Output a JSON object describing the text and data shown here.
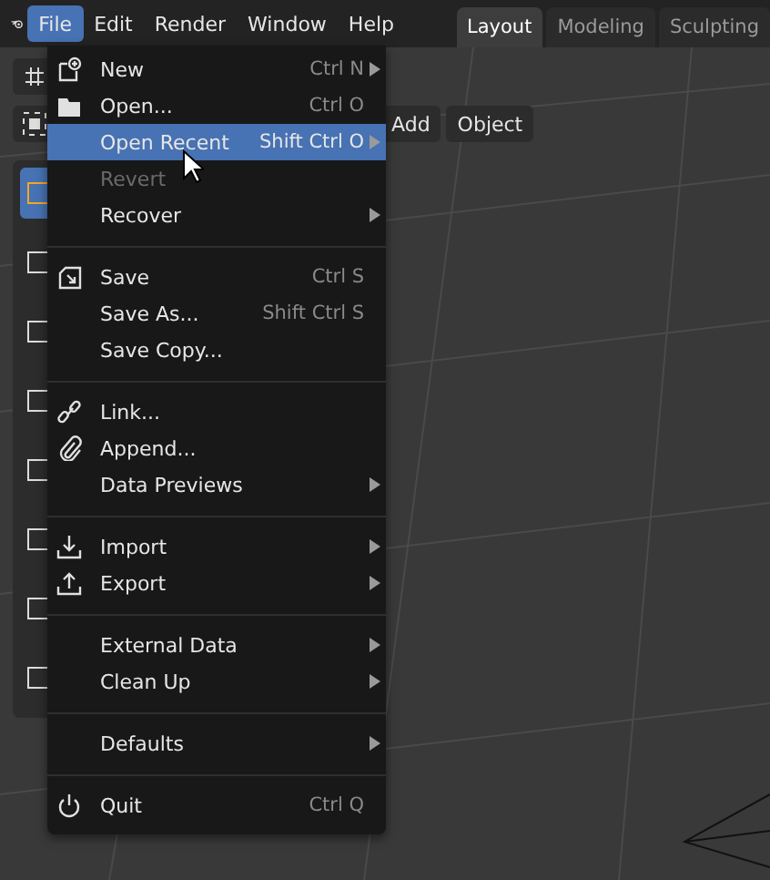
{
  "menubar": {
    "items": [
      {
        "label": "File",
        "selected": true
      },
      {
        "label": "Edit",
        "selected": false
      },
      {
        "label": "Render",
        "selected": false
      },
      {
        "label": "Window",
        "selected": false
      },
      {
        "label": "Help",
        "selected": false
      }
    ]
  },
  "workspace_tabs": [
    {
      "label": "Layout",
      "selected": true
    },
    {
      "label": "Modeling",
      "selected": false
    },
    {
      "label": "Sculpting",
      "selected": false
    }
  ],
  "viewport_header": {
    "buttons": [
      "Add",
      "Object"
    ]
  },
  "file_menu": {
    "items": [
      {
        "kind": "item",
        "label": "New",
        "shortcut": "Ctrl N",
        "submenu": true,
        "selected": false,
        "disabled": false
      },
      {
        "kind": "item",
        "label": "Open...",
        "shortcut": "Ctrl O",
        "submenu": false,
        "selected": false,
        "disabled": false
      },
      {
        "kind": "item",
        "label": "Open Recent",
        "shortcut": "Shift Ctrl O",
        "submenu": true,
        "selected": true,
        "disabled": false
      },
      {
        "kind": "item",
        "label": "Revert",
        "submenu": false,
        "selected": false,
        "disabled": true
      },
      {
        "kind": "item",
        "label": "Recover",
        "submenu": true,
        "selected": false,
        "disabled": false
      },
      {
        "kind": "separator"
      },
      {
        "kind": "item",
        "label": "Save",
        "shortcut": "Ctrl S",
        "submenu": false,
        "selected": false,
        "disabled": false
      },
      {
        "kind": "item",
        "label": "Save As...",
        "shortcut": "Shift Ctrl S",
        "submenu": false,
        "selected": false,
        "disabled": false
      },
      {
        "kind": "item",
        "label": "Save Copy...",
        "submenu": false,
        "selected": false,
        "disabled": false
      },
      {
        "kind": "separator"
      },
      {
        "kind": "item",
        "label": "Link...",
        "submenu": false,
        "selected": false,
        "disabled": false
      },
      {
        "kind": "item",
        "label": "Append...",
        "submenu": false,
        "selected": false,
        "disabled": false
      },
      {
        "kind": "item",
        "label": "Data Previews",
        "submenu": true,
        "selected": false,
        "disabled": false
      },
      {
        "kind": "separator"
      },
      {
        "kind": "item",
        "label": "Import",
        "submenu": true,
        "selected": false,
        "disabled": false
      },
      {
        "kind": "item",
        "label": "Export",
        "submenu": true,
        "selected": false,
        "disabled": false
      },
      {
        "kind": "separator"
      },
      {
        "kind": "item",
        "label": "External Data",
        "submenu": true,
        "selected": false,
        "disabled": false
      },
      {
        "kind": "item",
        "label": "Clean Up",
        "submenu": true,
        "selected": false,
        "disabled": false
      },
      {
        "kind": "separator"
      },
      {
        "kind": "item",
        "label": "Defaults",
        "submenu": true,
        "selected": false,
        "disabled": false
      },
      {
        "kind": "separator"
      },
      {
        "kind": "item",
        "label": "Quit",
        "shortcut": "Ctrl Q",
        "submenu": false,
        "selected": false,
        "disabled": false
      }
    ]
  }
}
